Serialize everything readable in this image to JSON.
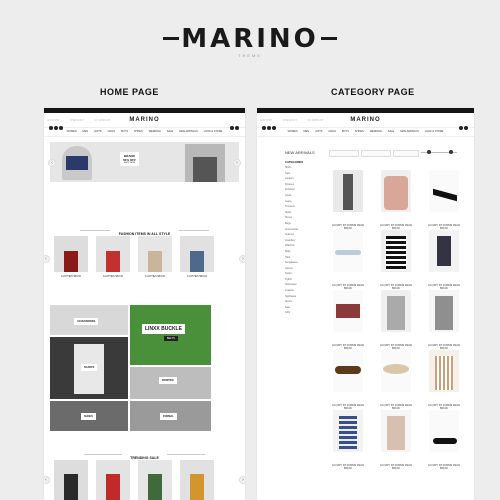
{
  "brand": {
    "logo": "MARINO",
    "tagline": "THEME"
  },
  "sections": {
    "home_title": "HOME PAGE",
    "category_title": "CATEGORY PAGE"
  },
  "home": {
    "topbar": [
      "ACCOUNT",
      "CHECKOUT",
      "MY WISHLIST"
    ],
    "logo": "MARINO",
    "nav": [
      "WOMEN",
      "MEN",
      "GIFTS",
      "GIRLS",
      "BOYS",
      "SHOES",
      "WEDDING",
      "SALE",
      "NEW ARRIVALS",
      "LOOK & STORE"
    ],
    "hero": {
      "collection": "BRAND",
      "discount": "50% OFF",
      "shop": "SHOP NOW"
    },
    "fashion_heading": "FASHION ITEMS IN ALL STYLE",
    "products": [
      {
        "name": "CLOTHES",
        "price": "$59.00"
      },
      {
        "name": "CLOTHES",
        "price": "$59.00"
      },
      {
        "name": "CLOTHES",
        "price": "$59.00"
      },
      {
        "name": "CLOTHES",
        "price": "$59.00"
      }
    ],
    "banners": {
      "accessories": "ACCESSORIES",
      "linxx": "LINXX BUCKLE",
      "belts": "BELTS",
      "scarfs": "SCARFS",
      "bowties": "BOWTIES",
      "shoes": "SHOES",
      "formal": "FORMAL"
    },
    "trending_heading": "TRENDING SALE"
  },
  "category": {
    "topbar": [
      "ACCOUNT",
      "CHECKOUT",
      "MY WISHLIST"
    ],
    "logo": "MARINO",
    "nav": [
      "WOMEN",
      "MEN",
      "GIFTS",
      "GIRLS",
      "BOYS",
      "SHOES",
      "WEDDING",
      "SALE",
      "NEW ARRIVALS",
      "LOOK & STORE"
    ],
    "page_heading": "NEW ARRIVALS",
    "sidebar_title": "CATEGORIES",
    "sidebar_items": [
      "Shirts",
      "Tops",
      "Jackets",
      "Dresses",
      "Knitwear",
      "Coats",
      "Jeans",
      "Trousers",
      "Skirts",
      "Shoes",
      "Bags",
      "Accessories",
      "Scarves",
      "Jewellery",
      "Watches",
      "Belts",
      "Hats",
      "Sunglasses",
      "Gloves",
      "Socks",
      "Tights",
      "Swimwear",
      "Lingerie",
      "Nightwear",
      "Sports",
      "Sale",
      "Gifts"
    ],
    "product_name": "LUXURY FIT FORUM FIELD",
    "product_price": "$59.00"
  },
  "colors": {
    "dark": "#151515",
    "bg": "#ededed",
    "frame": "#ffffff"
  }
}
